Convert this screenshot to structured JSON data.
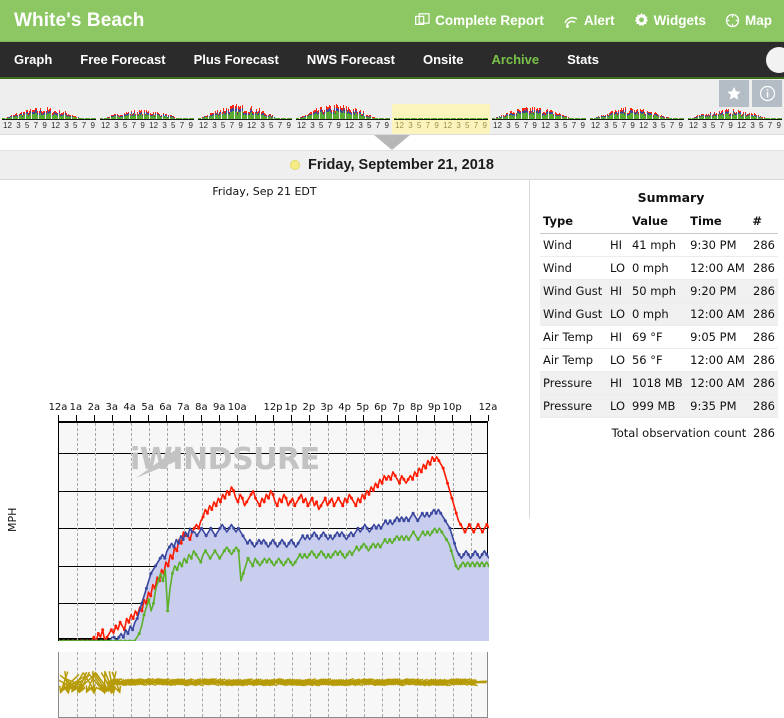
{
  "header": {
    "site_title": "White's Beach",
    "accent_green": "#8dc763",
    "actions": [
      {
        "label": "Complete Report",
        "icon": "window-copy-icon"
      },
      {
        "label": "Alert",
        "icon": "signal-wave-icon"
      },
      {
        "label": "Widgets",
        "icon": "gear-icon"
      },
      {
        "label": "Map",
        "icon": "globe-crosshair-icon"
      }
    ]
  },
  "nav": {
    "items": [
      {
        "label": "Graph",
        "active": false
      },
      {
        "label": "Free Forecast",
        "active": false
      },
      {
        "label": "Plus Forecast",
        "active": false
      },
      {
        "label": "NWS Forecast",
        "active": false
      },
      {
        "label": "Onsite",
        "active": false
      },
      {
        "label": "Archive",
        "active": true
      },
      {
        "label": "Stats",
        "active": false
      }
    ],
    "active_color": "#79c24a"
  },
  "archive_strip": {
    "buttons": [
      {
        "name": "favorite-star-button",
        "icon": "star-icon"
      },
      {
        "name": "info-button",
        "icon": "info-icon"
      }
    ],
    "hour_ticks": [
      "12",
      "3",
      "5",
      "7",
      "9",
      "12",
      "3",
      "5",
      "7",
      "9"
    ],
    "selected_day_index": 4,
    "day_count": 8
  },
  "date_selector": {
    "date_label": "Friday, September 21, 2018",
    "dot_color": "#f6ec86"
  },
  "chart_data": {
    "type": "line",
    "title": "Friday, Sep 21 EDT",
    "xlabel": "",
    "ylabel": "MPH",
    "ylim": [
      0,
      58
    ],
    "yticks": [
      0,
      10,
      20,
      30,
      40,
      50
    ],
    "xlim": [
      "12a",
      "12a"
    ],
    "xtick_labels": [
      "12a",
      "1a",
      "2a",
      "3a",
      "4a",
      "5a",
      "6a",
      "7a",
      "8a",
      "9a",
      "10a",
      "",
      "12p",
      "1p",
      "2p",
      "3p",
      "4p",
      "5p",
      "6p",
      "7p",
      "8p",
      "9p",
      "10p",
      "",
      "12a"
    ],
    "grid": true,
    "watermark": "iWINDSURE",
    "legend_position": "none",
    "series": [
      {
        "name": "Wind Gust",
        "color": "#ff1a00",
        "values": [
          0,
          0,
          0,
          0,
          0,
          0,
          0,
          0,
          0,
          0,
          0,
          0,
          0,
          0,
          0,
          0,
          1,
          0,
          2,
          1,
          3,
          0,
          1,
          2,
          3,
          2,
          4,
          3,
          5,
          4,
          3,
          6,
          5,
          7,
          6,
          8,
          7,
          9,
          8,
          11,
          10,
          13,
          12,
          15,
          14,
          17,
          16,
          19,
          18,
          21,
          20,
          23,
          22,
          25,
          24,
          27,
          26,
          29,
          28,
          28,
          27,
          29,
          30,
          31,
          30,
          32,
          33,
          35,
          34,
          36,
          35,
          37,
          36,
          38,
          37,
          39,
          38,
          40,
          39,
          41,
          40,
          38,
          37,
          39,
          38,
          36,
          37,
          38,
          39,
          40,
          38,
          37,
          36,
          38,
          37,
          39,
          38,
          40,
          39,
          37,
          36,
          38,
          37,
          39,
          38,
          36,
          37,
          38,
          36,
          37,
          38,
          39,
          37,
          38,
          36,
          37,
          38,
          36,
          37,
          35,
          36,
          37,
          38,
          36,
          37,
          38,
          36,
          37,
          38,
          37,
          36,
          38,
          37,
          39,
          38,
          37,
          36,
          38,
          37,
          39,
          38,
          40,
          39,
          41,
          40,
          42,
          41,
          43,
          42,
          44,
          43,
          44,
          43,
          45,
          44,
          43,
          42,
          44,
          43,
          42,
          43,
          44,
          43,
          45,
          44,
          46,
          45,
          47,
          46,
          48,
          47,
          49,
          48,
          49,
          48,
          47,
          46,
          44,
          42,
          40,
          38,
          36,
          34,
          32,
          31,
          30,
          29,
          30,
          31,
          30,
          29,
          30,
          31,
          30,
          29,
          30,
          31,
          30
        ]
      },
      {
        "name": "Wind Average",
        "color": "#39479e",
        "values": [
          0,
          0,
          0,
          0,
          0,
          0,
          0,
          0,
          0,
          0,
          0,
          0,
          0,
          0,
          0,
          0,
          0,
          0,
          0,
          0,
          0,
          0,
          0,
          1,
          1,
          0,
          1,
          2,
          1,
          3,
          2,
          4,
          3,
          5,
          6,
          8,
          10,
          12,
          14,
          16,
          18,
          19,
          20,
          21,
          22,
          23,
          22,
          24,
          25,
          26,
          25,
          27,
          26,
          28,
          27,
          29,
          28,
          30,
          29,
          29,
          28,
          29,
          30,
          29,
          28,
          29,
          30,
          29,
          28,
          29,
          30,
          31,
          30,
          29,
          30,
          31,
          30,
          29,
          30,
          29,
          28,
          27,
          26,
          27,
          26,
          25,
          26,
          27,
          26,
          27,
          26,
          25,
          26,
          27,
          26,
          25,
          26,
          27,
          26,
          25,
          26,
          27,
          26,
          25,
          26,
          27,
          28,
          27,
          28,
          27,
          28,
          29,
          28,
          27,
          28,
          29,
          28,
          27,
          28,
          27,
          28,
          29,
          28,
          29,
          28,
          27,
          28,
          29,
          28,
          29,
          30,
          29,
          30,
          31,
          30,
          29,
          30,
          31,
          30,
          31,
          30,
          31,
          32,
          31,
          32,
          31,
          32,
          33,
          32,
          33,
          32,
          33,
          32,
          33,
          34,
          33,
          32,
          33,
          34,
          33,
          34,
          33,
          34,
          35,
          34,
          35,
          34,
          33,
          32,
          31,
          30,
          28,
          26,
          24,
          23,
          22,
          23,
          24,
          23,
          22,
          23,
          24,
          23,
          22,
          23,
          24,
          23,
          22
        ]
      },
      {
        "name": "Wind Lull",
        "color": "#5bb02a",
        "values": [
          0,
          0,
          0,
          0,
          0,
          0,
          0,
          0,
          0,
          0,
          0,
          0,
          0,
          0,
          0,
          0,
          0,
          0,
          0,
          0,
          0,
          0,
          0,
          0,
          0,
          0,
          0,
          0,
          0,
          0,
          0,
          0,
          0,
          1,
          2,
          4,
          7,
          9,
          11,
          8,
          10,
          14,
          16,
          18,
          16,
          19,
          8,
          14,
          18,
          20,
          19,
          21,
          20,
          22,
          21,
          23,
          22,
          24,
          23,
          22,
          21,
          23,
          24,
          23,
          22,
          23,
          24,
          23,
          22,
          23,
          24,
          25,
          24,
          23,
          24,
          25,
          24,
          16,
          18,
          20,
          22,
          21,
          20,
          22,
          21,
          20,
          21,
          22,
          21,
          22,
          21,
          20,
          21,
          22,
          21,
          20,
          21,
          22,
          21,
          20,
          21,
          22,
          23,
          22,
          23,
          22,
          23,
          24,
          23,
          22,
          23,
          24,
          23,
          22,
          23,
          22,
          23,
          24,
          23,
          24,
          23,
          22,
          23,
          24,
          23,
          24,
          25,
          24,
          25,
          26,
          25,
          24,
          25,
          26,
          25,
          26,
          25,
          26,
          27,
          26,
          27,
          26,
          27,
          28,
          27,
          28,
          27,
          28,
          27,
          28,
          29,
          28,
          27,
          28,
          29,
          28,
          29,
          28,
          29,
          30,
          29,
          30,
          29,
          28,
          27,
          26,
          24,
          22,
          20,
          19,
          20,
          21,
          20,
          21,
          20,
          21,
          20,
          21,
          20,
          21,
          20,
          21,
          20
        ]
      }
    ],
    "fill_color": "#c9cdee",
    "direction_strip": {
      "color": "#b79b06",
      "name": "wind-direction-arrows"
    }
  },
  "summary": {
    "title": "Summary",
    "columns": [
      "Type",
      "",
      "Value",
      "Time",
      "#"
    ],
    "rows": [
      {
        "type": "Wind",
        "hl": "HI",
        "value": "41 mph",
        "time": "9:30 PM",
        "count": "286"
      },
      {
        "type": "Wind",
        "hl": "LO",
        "value": "0 mph",
        "time": "12:00 AM",
        "count": "286"
      },
      {
        "type": "Wind Gust",
        "hl": "HI",
        "value": "50 mph",
        "time": "9:20 PM",
        "count": "286"
      },
      {
        "type": "Wind Gust",
        "hl": "LO",
        "value": "0 mph",
        "time": "12:00 AM",
        "count": "286"
      },
      {
        "type": "Air Temp",
        "hl": "HI",
        "value": "69 °F",
        "time": "9:05 PM",
        "count": "286"
      },
      {
        "type": "Air Temp",
        "hl": "LO",
        "value": "56 °F",
        "time": "12:00 AM",
        "count": "286"
      },
      {
        "type": "Pressure",
        "hl": "HI",
        "value": "1018 MB",
        "time": "12:00 AM",
        "count": "286"
      },
      {
        "type": "Pressure",
        "hl": "LO",
        "value": "999 MB",
        "time": "9:35 PM",
        "count": "286"
      }
    ],
    "total_label": "Total observation count",
    "total_value": "286"
  }
}
